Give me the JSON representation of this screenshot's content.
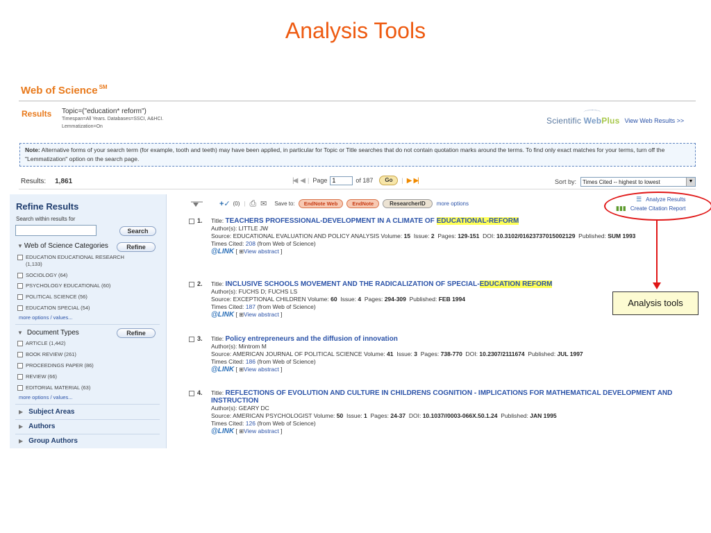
{
  "slide": {
    "title": "Analysis Tools"
  },
  "wos": {
    "title": "Web of Science",
    "mark": "SM"
  },
  "results_header": {
    "label": "Results",
    "query": "Topic=(\"education* reform\")",
    "meta_line1": "Timespan=All Years. Databases=SSCI, A&HCI.",
    "meta_line2": "Lemmatization=On"
  },
  "webplus": {
    "logo_prefix": "Scientific",
    "logo_web": "Web",
    "logo_plus": "Plus",
    "link": "View Web Results >>"
  },
  "note": {
    "label": "Note:",
    "text": "Alternative forms of your search term (for example, tooth and teeth) may have been applied, in particular for Topic or Title searches that do not contain quotation marks around the terms. To find only exact matches for your terms, turn off the \"Lemmatization\" option on the search page."
  },
  "results_bar": {
    "label": "Results:",
    "count": "1,861",
    "page_label": "Page",
    "page_value": "1",
    "of_pages": "of 187",
    "go": "Go",
    "sort_label": "Sort by:",
    "sort_value": "Times Cited -- highest to lowest"
  },
  "sidebar": {
    "title": "Refine Results",
    "search_label": "Search within results for",
    "search_button": "Search",
    "refine_button": "Refine",
    "sections": [
      {
        "title": "Web of Science Categories",
        "items": [
          {
            "label": "EDUCATION EDUCATIONAL RESEARCH",
            "count": "(1,133)"
          },
          {
            "label": "SOCIOLOGY (64)"
          },
          {
            "label": "PSYCHOLOGY EDUCATIONAL (60)"
          },
          {
            "label": "POLITICAL SCIENCE (56)"
          },
          {
            "label": "EDUCATION SPECIAL (54)"
          }
        ],
        "more": "more options / values..."
      },
      {
        "title": "Document Types",
        "items": [
          {
            "label": "ARTICLE (1,442)"
          },
          {
            "label": "BOOK REVIEW (261)"
          },
          {
            "label": "PROCEEDINGS PAPER (86)"
          },
          {
            "label": "REVIEW (66)"
          },
          {
            "label": "EDITORIAL MATERIAL (63)"
          }
        ],
        "more": "more options / values..."
      }
    ],
    "collapsed": [
      "Subject Areas",
      "Authors",
      "Group Authors"
    ]
  },
  "toolbar": {
    "marked_count": "(0)",
    "save_to": "Save to:",
    "endnote_web": "EndNote Web",
    "endnote": "EndNote",
    "researcherid": "ResearcherID",
    "more_options": "more options"
  },
  "analysis_links": {
    "analyze": "Analyze Results",
    "citation": "Create Citation Report"
  },
  "callout": {
    "text": "Analysis tools"
  },
  "records": [
    {
      "num": "1.",
      "title_label": "Title:",
      "title_plain": "TEACHERS PROFESSIONAL-DEVELOPMENT IN A CLIMATE OF ",
      "title_hl": "EDUCATIONAL-REFORM",
      "authors": "Author(s): LITTLE JW",
      "source_pre": "Source: EDUCATIONAL EVALUATION AND POLICY ANALYSIS  Volume: ",
      "volume": "15",
      "issue": "2",
      "pages": "129-151",
      "doi": "10.3102/01623737015002129",
      "published": "SUM 1993",
      "times_cited": "208",
      "cited_suffix": " (from Web of Science)",
      "abstract": "View abstract"
    },
    {
      "num": "2.",
      "title_label": "Title:",
      "title_plain": "INCLUSIVE SCHOOLS MOVEMENT AND THE RADICALIZATION OF SPECIAL-",
      "title_hl": "EDUCATION REFORM",
      "authors": "Author(s): FUCHS D; FUCHS LS",
      "source_pre": "Source: EXCEPTIONAL CHILDREN  Volume: ",
      "volume": "60",
      "issue": "4",
      "pages": "294-309",
      "published": "FEB 1994",
      "times_cited": "187",
      "cited_suffix": " (from Web of Science)",
      "abstract": "View abstract"
    },
    {
      "num": "3.",
      "title_label": "Title:",
      "title_plain": "Policy entrepreneurs and the diffusion of innovation",
      "authors": "Author(s): Mintrom M",
      "source_pre": "Source: AMERICAN JOURNAL OF POLITICAL SCIENCE  Volume: ",
      "volume": "41",
      "issue": "3",
      "pages": "738-770",
      "doi": "10.2307/2111674",
      "published": "JUL 1997",
      "times_cited": "186",
      "cited_suffix": " (from Web of Science)",
      "abstract": "View abstract"
    },
    {
      "num": "4.",
      "title_label": "Title:",
      "title_plain": "REFLECTIONS OF EVOLUTION AND CULTURE IN CHILDRENS COGNITION - IMPLICATIONS FOR MATHEMATICAL DEVELOPMENT AND INSTRUCTION",
      "authors": "Author(s): GEARY DC",
      "source_pre": "Source: AMERICAN PSYCHOLOGIST  Volume: ",
      "volume": "50",
      "issue": "1",
      "pages": "24-37",
      "doi": "10.1037//0003-066X.50.1.24",
      "published": "JAN 1995",
      "times_cited": "126",
      "cited_suffix": " (from Web of Science)",
      "abstract": "View abstract"
    }
  ],
  "labels": {
    "issue": "Issue:",
    "pages": "Pages:",
    "doi": "DOI:",
    "published": "Published:",
    "times_cited": "Times Cited:",
    "elink": "LINK"
  }
}
